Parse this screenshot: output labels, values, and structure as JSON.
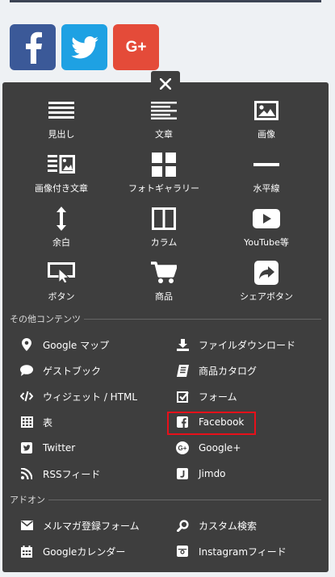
{
  "colors": {
    "page_bg": "#eef1f4",
    "panel_bg": "#3e3e3e",
    "facebook": "#3b5998",
    "twitter": "#1ea1e3",
    "googleplus": "#e44b39",
    "highlight": "#e8101a"
  },
  "social": [
    {
      "name": "facebook",
      "icon": "facebook-icon"
    },
    {
      "name": "twitter",
      "icon": "twitter-icon"
    },
    {
      "name": "googleplus",
      "icon": "google-plus-icon",
      "label": "G+"
    }
  ],
  "close_icon": "close-icon",
  "tiles": [
    {
      "label": "見出し",
      "icon": "heading-icon"
    },
    {
      "label": "文章",
      "icon": "text-icon"
    },
    {
      "label": "画像",
      "icon": "image-icon"
    },
    {
      "label": "画像付き文章",
      "icon": "text-with-image-icon"
    },
    {
      "label": "フォトギャラリー",
      "icon": "photo-gallery-icon"
    },
    {
      "label": "水平線",
      "icon": "horizontal-line-icon"
    },
    {
      "label": "余白",
      "icon": "spacer-icon"
    },
    {
      "label": "カラム",
      "icon": "columns-icon"
    },
    {
      "label": "YouTube等",
      "icon": "youtube-icon"
    },
    {
      "label": "ボタン",
      "icon": "button-icon"
    },
    {
      "label": "商品",
      "icon": "cart-icon"
    },
    {
      "label": "シェアボタン",
      "icon": "share-icon"
    }
  ],
  "sections": {
    "other": "その他コンテンツ",
    "addon": "アドオン"
  },
  "other_items": [
    {
      "label": "Google マップ",
      "icon": "map-pin-icon"
    },
    {
      "label": "ファイルダウンロード",
      "icon": "download-icon"
    },
    {
      "label": "ゲストブック",
      "icon": "speech-bubble-icon"
    },
    {
      "label": "商品カタログ",
      "icon": "catalog-icon"
    },
    {
      "label": "ウィジェット / HTML",
      "icon": "code-icon"
    },
    {
      "label": "フォーム",
      "icon": "checkbox-icon"
    },
    {
      "label": "表",
      "icon": "table-icon"
    },
    {
      "label": "Facebook",
      "icon": "facebook-square-icon"
    },
    {
      "label": "Twitter",
      "icon": "twitter-square-icon"
    },
    {
      "label": "Google+",
      "icon": "google-plus-circle-icon"
    },
    {
      "label": "RSSフィード",
      "icon": "rss-icon"
    },
    {
      "label": "Jimdo",
      "icon": "jimdo-icon"
    }
  ],
  "addon_items": [
    {
      "label": "メルマガ登録フォーム",
      "icon": "envelope-icon"
    },
    {
      "label": "カスタム検索",
      "icon": "search-icon"
    },
    {
      "label": "Googleカレンダー",
      "icon": "calendar-icon"
    },
    {
      "label": "Instagramフィード",
      "icon": "instagram-icon"
    }
  ]
}
